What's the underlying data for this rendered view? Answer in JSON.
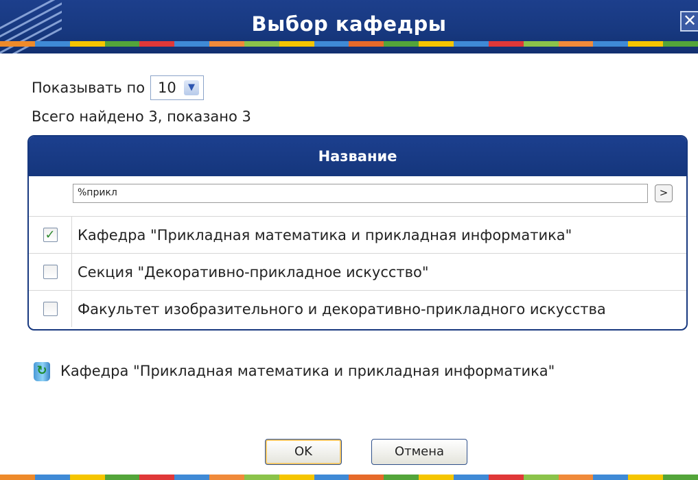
{
  "window": {
    "title": "Выбор кафедры",
    "close_label": "✕"
  },
  "colors": {
    "title_bar": "#17387f",
    "accent": "#2d55b0"
  },
  "stripe_colors": [
    "#ee8a2a",
    "#3f8ad6",
    "#f5c500",
    "#53a53a",
    "#e03838",
    "#3f8ad6",
    "#f08a3a",
    "#8bc34a",
    "#f5c500",
    "#3f8ad6",
    "#e66a2a",
    "#53a53a",
    "#f5c500",
    "#3f8ad6",
    "#e03838",
    "#8bc34a",
    "#f08a3a",
    "#3f8ad6",
    "#f5c500",
    "#53a53a"
  ],
  "paging": {
    "label": "Показывать по",
    "selected": "10",
    "dropdown_icon": "chevron-down-icon"
  },
  "summary": "Всего найдено 3, показано 3",
  "grid": {
    "column_header": "Название",
    "filter": {
      "value": "%прикл",
      "go_label": ">"
    },
    "rows": [
      {
        "checked": true,
        "name": "Кафедра \"Прикладная математика и прикладная информатика\""
      },
      {
        "checked": false,
        "name": "Секция \"Декоративно-прикладное искусство\""
      },
      {
        "checked": false,
        "name": "Факультет изобразительного и декоративно-прикладного искусства"
      }
    ]
  },
  "selected": {
    "icon": "recycle-bin-icon",
    "text": "Кафедра \"Прикладная математика и прикладная информатика\""
  },
  "buttons": {
    "ok": "OK",
    "cancel": "Отмена"
  }
}
